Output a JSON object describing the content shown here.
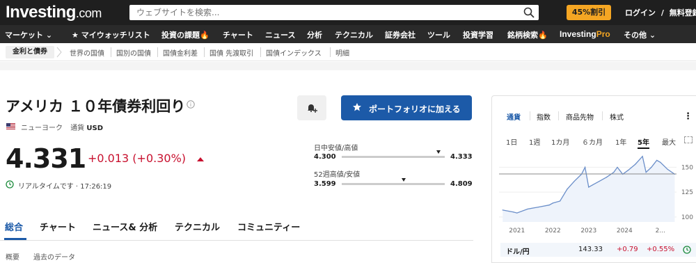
{
  "header": {
    "logo_main": "Investing",
    "logo_suffix": ".com",
    "search_placeholder": "ウェブサイトを検索...",
    "promo": "45%割引",
    "login": "ログイン",
    "slash": "/",
    "signup": "無料登録"
  },
  "nav": {
    "items": [
      "マーケット",
      "マイウォッチリスト",
      "投資の課題",
      "チャート",
      "ニュース",
      "分析",
      "テクニカル",
      "証券会社",
      "ツール",
      "投資学習",
      "銘柄検索",
      "InvestingPro",
      "その他"
    ],
    "market_chevron": "⌄",
    "watchlist_star": "★",
    "fire": "🔥",
    "other_chevron": "⌄",
    "pro_main": "Investing",
    "pro_suffix": "Pro"
  },
  "subnav": {
    "active": "金利と債券",
    "items": [
      "世界の国債",
      "国別の国債",
      "国債金利差",
      "国債 先渡取引",
      "国債インデックス",
      "明細"
    ]
  },
  "instrument": {
    "title": "アメリカ １０年債券利回り",
    "info_icon": "i",
    "exchange": "ニューヨーク",
    "currency_label": "通貨",
    "currency": "USD",
    "price": "4.331",
    "change": "+0.013 (+0.30%)",
    "realtime": "リアルタイムです · 17:26:19"
  },
  "actions": {
    "alert_icon": "bell-plus-icon",
    "portfolio_button": "ポートフォリオに加える"
  },
  "ranges": {
    "day_label": "日中安値/高値",
    "day_low": "4.300",
    "day_high": "4.333",
    "day_position": 0.94,
    "week52_label": "52週高値/安値",
    "week52_low": "3.599",
    "week52_high": "4.809",
    "week52_position": 0.6
  },
  "tabs": {
    "main": [
      "総合",
      "チャート",
      "ニュース& 分析",
      "テクニカル",
      "コミュニティー"
    ],
    "sub": [
      "概要",
      "過去のデータ"
    ]
  },
  "panel": {
    "tabs": [
      "通貨",
      "指数",
      "商品先物",
      "株式"
    ],
    "more": "⋮",
    "ranges": [
      "1日",
      "1週",
      "1カ月",
      "６カ月",
      "1年",
      "5年",
      "最大"
    ],
    "active_range": "5年",
    "quote": {
      "name": "ドル/円",
      "last": "143.33",
      "change": "+0.79",
      "change_pct": "+0.55%"
    }
  },
  "chart_data": {
    "type": "line",
    "x": [
      "2020.6",
      "2020.9",
      "2021.0",
      "2021.3",
      "2021.6",
      "2021.9",
      "2022.0",
      "2022.2",
      "2022.4",
      "2022.6",
      "2022.8",
      "2022.9",
      "2023.0",
      "2023.1",
      "2023.3",
      "2023.5",
      "2023.7",
      "2023.8",
      "2023.95",
      "2024.1",
      "2024.3",
      "2024.5",
      "2024.6",
      "2024.75",
      "2024.9",
      "2025.0",
      "2025.2",
      "2025.4"
    ],
    "y": [
      107,
      105,
      104,
      108,
      110,
      112,
      114,
      116,
      128,
      136,
      143,
      150,
      130,
      132,
      136,
      140,
      145,
      150,
      143,
      147,
      153,
      161,
      145,
      150,
      157,
      155,
      148,
      143
    ],
    "xticks": [
      "2021",
      "2022",
      "2023",
      "2024",
      "2..."
    ],
    "yticks": [
      "150",
      "125",
      "100"
    ],
    "ylim": [
      95,
      165
    ],
    "xlim": [
      2020.5,
      2025.45
    ],
    "reference_line": 143.33,
    "color": "#6a8ec9"
  }
}
